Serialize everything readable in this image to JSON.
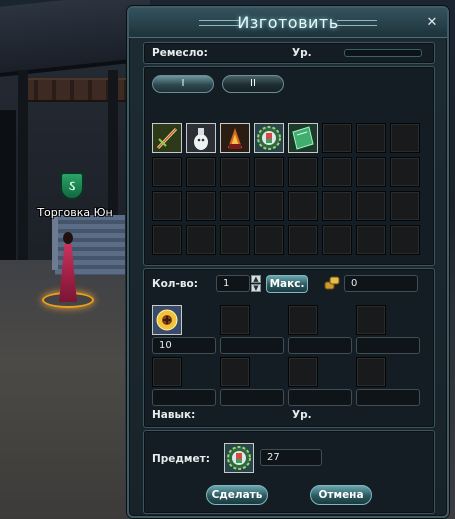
{
  "scene": {
    "npc_name": "Торговка Юн"
  },
  "window": {
    "title": "Изготовить",
    "close_glyph": "✕"
  },
  "header": {
    "craft_label": "Ремесло:",
    "level_label": "Ур."
  },
  "tabs": [
    {
      "label": "I",
      "active": true
    },
    {
      "label": "II",
      "active": false
    }
  ],
  "recipes": {
    "items": [
      {
        "icon": "sword-icon"
      },
      {
        "icon": "ghost-flask-icon"
      },
      {
        "icon": "flame-potion-icon"
      },
      {
        "icon": "gear-gem-icon"
      },
      {
        "icon": "green-tome-icon"
      }
    ]
  },
  "quantity": {
    "label": "Кол-во:",
    "value": "1",
    "max_label": "Макс.",
    "cost_value": "0"
  },
  "materials": [
    {
      "has_item": true,
      "icon": "sun-medallion-icon",
      "count": "10"
    },
    {
      "has_item": false,
      "count": ""
    },
    {
      "has_item": false,
      "count": ""
    },
    {
      "has_item": false,
      "count": ""
    },
    {
      "has_item": false,
      "count": ""
    },
    {
      "has_item": false,
      "count": ""
    },
    {
      "has_item": false,
      "count": ""
    },
    {
      "has_item": false,
      "count": ""
    }
  ],
  "footer": {
    "skill_label": "Навык:",
    "level_label": "Ур."
  },
  "result": {
    "label": "Предмет:",
    "icon": "gear-gem-icon",
    "count": "27"
  },
  "actions": {
    "make_label": "Сделать",
    "cancel_label": "Отмена"
  }
}
